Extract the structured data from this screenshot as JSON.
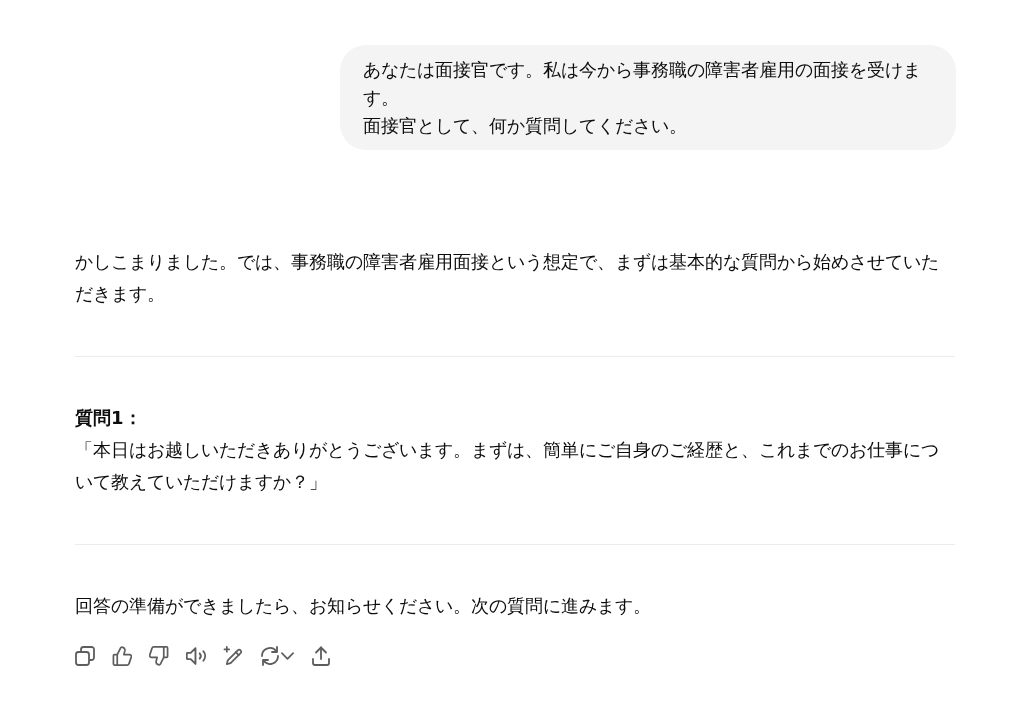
{
  "user_message": {
    "lines": [
      "あなたは面接官です。私は今から事務職の障害者雇用の面接を受けます。",
      "面接官として、何か質問してください。"
    ]
  },
  "assistant_message": {
    "blocks": [
      {
        "kind": "paragraph",
        "text": "かしこまりました。では、事務職の障害者雇用面接という想定で、まずは基本的な質問から始めさせていただきます。"
      },
      {
        "kind": "divider"
      },
      {
        "kind": "question",
        "label": "質問1：",
        "text": "「本日はお越しいただきありがとうございます。まずは、簡単にご自身のご経歴と、これまでのお仕事について教えていただけますか？」"
      },
      {
        "kind": "divider"
      },
      {
        "kind": "paragraph",
        "text": "回答の準備ができましたら、お知らせください。次の質問に進みます。"
      }
    ],
    "actions": [
      {
        "kind": "copy"
      },
      {
        "kind": "thumbs-up"
      },
      {
        "kind": "thumbs-down"
      },
      {
        "kind": "speaker"
      },
      {
        "kind": "pencil-sparkle"
      },
      {
        "kind": "refresh-menu"
      },
      {
        "kind": "upload"
      }
    ]
  }
}
